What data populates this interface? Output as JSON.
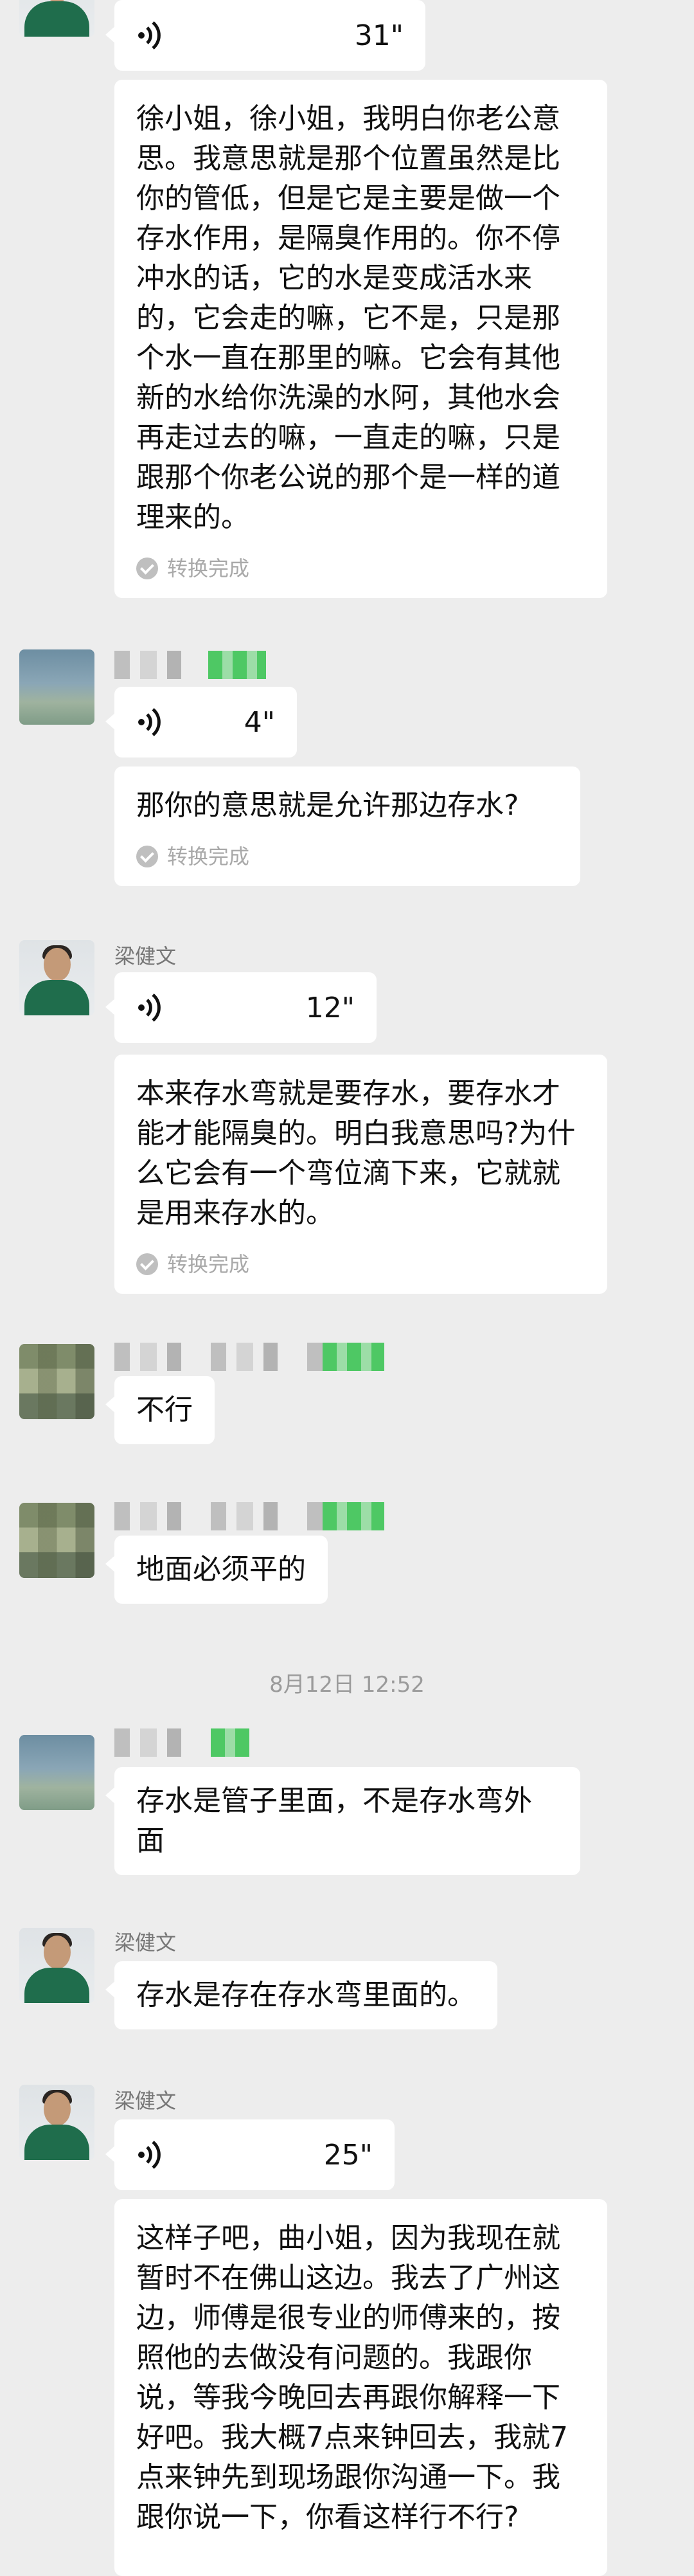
{
  "messages": {
    "m1": {
      "duration": "31\"",
      "text": "徐小姐，徐小姐，我明白你老公意思。我意思就是那个位置虽然是比你的管低，但是它是主要是做一个存水作用，是隔臭作用的。你不停冲水的话，它的水是变成活水来的，它会走的嘛，它不是，只是那个水一直在那里的嘛。它会有其他新的水给你洗澡的水阿，其他水会再走过去的嘛，一直走的嘛，只是跟那个你老公说的那个是一样的道理来的。",
      "status": "转换完成"
    },
    "m2": {
      "duration": "4\"",
      "text": "那你的意思就是允许那边存水?",
      "status": "转换完成"
    },
    "m3": {
      "sender": "梁健文",
      "duration": "12\"",
      "text": "本来存水弯就是要存水，要存水才能才能隔臭的。明白我意思吗?为什么它会有一个弯位滴下来，它就就是用来存水的。",
      "status": "转换完成"
    },
    "m4": {
      "text": "不行"
    },
    "m5": {
      "text": "地面必须平的"
    },
    "timestamp": "8月12日 12:52",
    "m6": {
      "text": "存水是管子里面，不是存水弯外面"
    },
    "m7": {
      "sender": "梁健文",
      "text": "存水是存在存水弯里面的。"
    },
    "m8": {
      "sender": "梁健文",
      "duration": "25\"",
      "text": "这样子吧，曲小姐，因为我现在就暂时不在佛山这边。我去了广州这边，师傅是很专业的师傅来的，按照他的去做没有问题的。我跟你说，等我今晚回去再跟你解释一下好吧。我大概7点来钟回去，我就7点来钟先到现场跟你沟通一下。我跟你说一下，你看这样行不行?"
    }
  },
  "icons": {
    "voice": "voice-wave-icon",
    "check": "check-circle-icon"
  }
}
